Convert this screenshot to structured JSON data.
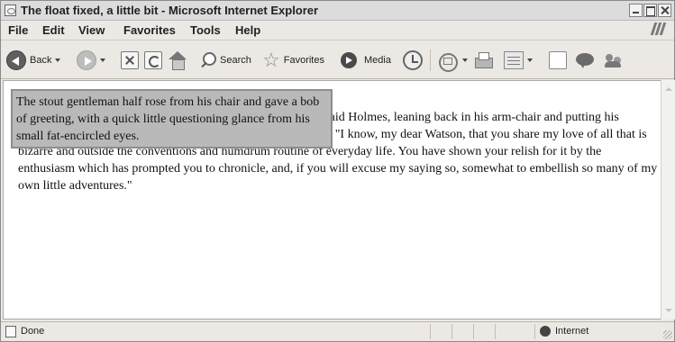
{
  "window": {
    "title": "The float fixed, a little bit - Microsoft Internet Explorer"
  },
  "menu": [
    "File",
    "Edit",
    "View",
    "Favorites",
    "Tools",
    "Help"
  ],
  "toolbar": {
    "back_label": "Back",
    "search_label": "Search",
    "favorites_label": "Favorites",
    "media_label": "Media"
  },
  "page": {
    "float_text": "The stout gentleman half rose from his chair and gave a bob of greeting, with a quick little questioning glance from his small fat-encircled eyes.",
    "body_text": "\"You will remember, Watson, that I am not in the least tired, said Holmes, leaning back in his arm-chair and putting his fingertips together, as was his custom when in judicial moods. \"I know, my dear Watson, that you share my love of all that is bizarre and outside the conventions and humdrum routine of everyday life. You have shown your relish for it by the enthusiasm which has prompted you to chronicle, and, if you will excuse my saying so, somewhat to embellish so many of my own little adventures.\""
  },
  "status": {
    "text": "Done",
    "zone": "Internet"
  }
}
